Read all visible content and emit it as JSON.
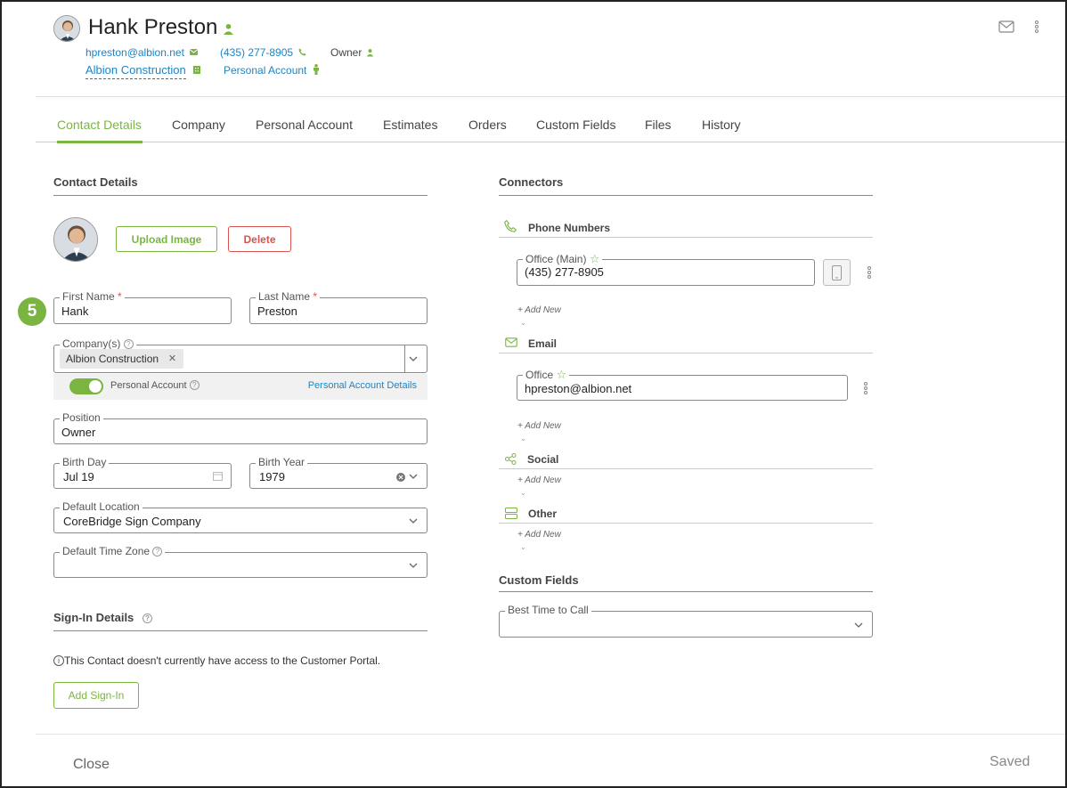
{
  "header": {
    "name": "Hank Preston",
    "email": "hpreston@albion.net",
    "phone": "(435) 277-8905",
    "role": "Owner",
    "company": "Albion Construction",
    "personal_account": "Personal Account"
  },
  "tabs": [
    {
      "label": "Contact Details",
      "active": true
    },
    {
      "label": "Company"
    },
    {
      "label": "Personal Account"
    },
    {
      "label": "Estimates"
    },
    {
      "label": "Orders"
    },
    {
      "label": "Custom Fields"
    },
    {
      "label": "Files"
    },
    {
      "label": "History"
    }
  ],
  "step_badge": "5",
  "contact_details": {
    "title": "Contact Details",
    "upload_label": "Upload Image",
    "delete_label": "Delete",
    "first_name": {
      "label": "First Name",
      "value": "Hank"
    },
    "last_name": {
      "label": "Last Name",
      "value": "Preston"
    },
    "companies": {
      "label": "Company(s)",
      "chip": "Albion Construction"
    },
    "personal_toggle_label": "Personal Account",
    "personal_details_link": "Personal Account Details",
    "position": {
      "label": "Position",
      "value": "Owner"
    },
    "birth_day": {
      "label": "Birth Day",
      "value": "Jul 19"
    },
    "birth_year": {
      "label": "Birth Year",
      "value": "1979"
    },
    "default_location": {
      "label": "Default Location",
      "value": "CoreBridge Sign Company"
    },
    "default_tz": {
      "label": "Default Time Zone",
      "value": ""
    }
  },
  "signin": {
    "title": "Sign-In Details",
    "message": "This Contact doesn't currently have access to the Customer Portal.",
    "button": "Add Sign-In"
  },
  "connectors": {
    "title": "Connectors",
    "phone_title": "Phone Numbers",
    "phone_label": "Office (Main)",
    "phone_value": "(435) 277-8905",
    "email_title": "Email",
    "email_label": "Office",
    "email_value": "hpreston@albion.net",
    "social_title": "Social",
    "other_title": "Other",
    "add_new": "+ Add New"
  },
  "custom_fields": {
    "title": "Custom Fields",
    "best_time_label": "Best Time to Call",
    "best_time_value": ""
  },
  "footer": {
    "close": "Close",
    "status": "Saved"
  },
  "colors": {
    "accent": "#7ab542",
    "link": "#1a85c8",
    "danger": "#d9534f"
  }
}
